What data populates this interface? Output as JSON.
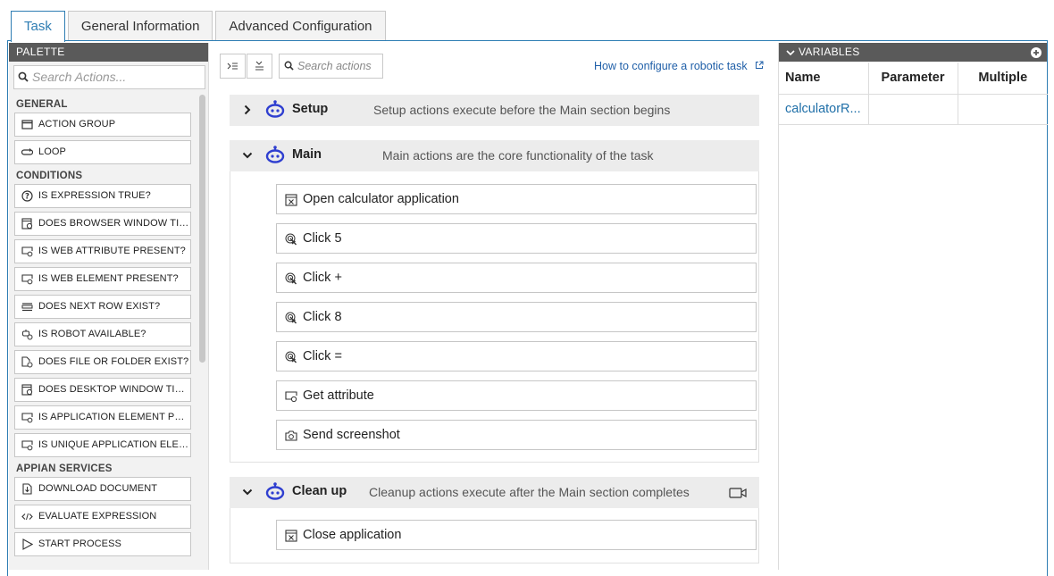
{
  "tabs": [
    "Task",
    "General Information",
    "Advanced Configuration"
  ],
  "palette": {
    "title": "PALETTE",
    "search_placeholder": "Search Actions...",
    "sections": {
      "general": "GENERAL",
      "conditions": "CONDITIONS",
      "appian": "APPIAN SERVICES"
    },
    "general_items": [
      "ACTION GROUP",
      "LOOP"
    ],
    "condition_items": [
      "IS EXPRESSION TRUE?",
      "DOES BROWSER WINDOW TITLE...",
      "IS WEB ATTRIBUTE PRESENT?",
      "IS WEB ELEMENT PRESENT?",
      "DOES NEXT ROW EXIST?",
      "IS ROBOT AVAILABLE?",
      "DOES FILE OR FOLDER EXIST?",
      "DOES DESKTOP WINDOW TITLE ...",
      "IS APPLICATION ELEMENT PRES...",
      "IS UNIQUE APPLICATION ELEME..."
    ],
    "appian_items": [
      "DOWNLOAD DOCUMENT",
      "EVALUATE EXPRESSION",
      "START PROCESS"
    ]
  },
  "toolbar": {
    "search_placeholder": "Search actions",
    "howto_link": "How to configure a robotic task"
  },
  "sections": {
    "setup": {
      "title": "Setup",
      "desc": "Setup actions execute before the Main section begins"
    },
    "main": {
      "title": "Main",
      "desc": "Main actions are the core functionality of the task"
    },
    "cleanup": {
      "title": "Clean up",
      "desc": "Cleanup actions execute after the Main section completes"
    }
  },
  "main_actions": [
    "Open calculator application",
    "Click 5",
    "Click +",
    "Click 8",
    "Click =",
    "Get attribute",
    "Send screenshot"
  ],
  "cleanup_actions": [
    "Close application"
  ],
  "variables": {
    "title": "VARIABLES",
    "columns": [
      "Name",
      "Parameter",
      "Multiple"
    ],
    "rows": [
      {
        "name": "calculatorR...",
        "parameter": "",
        "multiple": ""
      }
    ]
  },
  "colors": {
    "accent": "#2e7db3",
    "link": "#1f5fa8",
    "robot": "#2f3fd0"
  }
}
